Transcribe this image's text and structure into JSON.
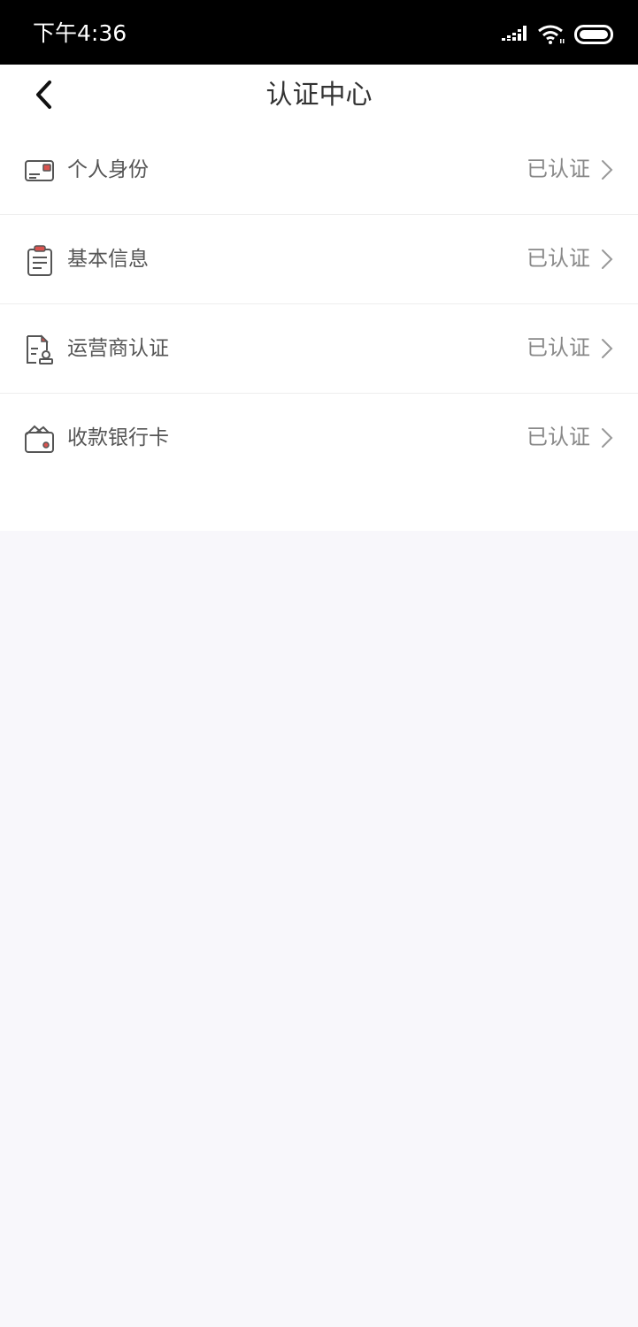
{
  "status_bar": {
    "time": "下午4:36",
    "icons": [
      "signal-icon",
      "wifi-icon",
      "battery-icon"
    ]
  },
  "header": {
    "title": "认证中心",
    "back_icon": "chevron-left-icon"
  },
  "items": [
    {
      "label": "个人身份",
      "status": "已认证",
      "icon": "id-card-icon"
    },
    {
      "label": "基本信息",
      "status": "已认证",
      "icon": "clipboard-icon"
    },
    {
      "label": "运营商认证",
      "status": "已认证",
      "icon": "operator-doc-icon"
    },
    {
      "label": "收款银行卡",
      "status": "已认证",
      "icon": "wallet-icon"
    }
  ],
  "colors": {
    "accent": "#d9534f",
    "icon_stroke": "#555555",
    "background": "#f8f7fb"
  }
}
